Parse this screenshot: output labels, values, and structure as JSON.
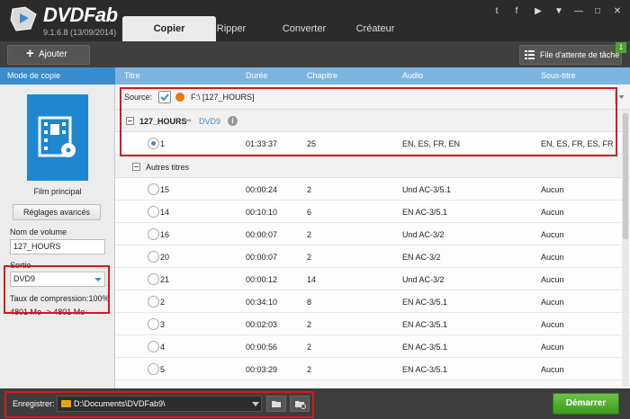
{
  "app": {
    "name": "DVDFab",
    "version": "9.1.6.8 (13/09/2014)"
  },
  "tabs": [
    "Copier",
    "Ripper",
    "Converter",
    "Créateur"
  ],
  "window_controls": {
    "twitter_glyph": "t",
    "facebook_glyph": "f",
    "youtube_glyph": "▶",
    "menu_glyph": "▼",
    "minimize_glyph": "—",
    "maximize_glyph": "□",
    "close_glyph": "✕"
  },
  "toolbar": {
    "add_label": "Ajouter",
    "add_glyph": "+",
    "queue_label": "File d'attente de tâche",
    "queue_badge": "1"
  },
  "left_panel": {
    "header": "Mode de copie",
    "mode_label": "Film principal",
    "advanced_button": "Réglages avancés",
    "volume_label": "Nom de volume",
    "volume_value": "127_HOURS",
    "output_label": "Sortie",
    "output_value": "DVD9",
    "compression_label": "Taux de compression:100%",
    "compression_size": "4801 Mo -> 4801 Mo"
  },
  "columns": {
    "title": "Titre",
    "duration": "Durée",
    "chapter": "Chapitre",
    "audio": "Audio",
    "subtitle": "Sous-titre"
  },
  "source": {
    "label": "Source:",
    "path": "F:\\ [127_HOURS]"
  },
  "main_title": {
    "name": "127_HOURS",
    "arrow": "➦",
    "format": "DVD9",
    "info_glyph": "i",
    "row": {
      "title": "1",
      "duration": "01:33:37",
      "chapter": "25",
      "audio": "EN, ES, FR, EN",
      "subtitle": "EN, ES, FR, ES, FR"
    }
  },
  "other_titles": {
    "label": "Autres titres",
    "rows": [
      {
        "title": "15",
        "duration": "00:00:24",
        "chapter": "2",
        "audio": "Und AC-3/5.1",
        "subtitle": "Aucun"
      },
      {
        "title": "14",
        "duration": "00:10:10",
        "chapter": "6",
        "audio": "EN AC-3/5.1",
        "subtitle": "Aucun"
      },
      {
        "title": "16",
        "duration": "00:00:07",
        "chapter": "2",
        "audio": "Und AC-3/2",
        "subtitle": "Aucun"
      },
      {
        "title": "20",
        "duration": "00:00:07",
        "chapter": "2",
        "audio": "EN AC-3/2",
        "subtitle": "Aucun"
      },
      {
        "title": "21",
        "duration": "00:00:12",
        "chapter": "14",
        "audio": "Und AC-3/2",
        "subtitle": "Aucun"
      },
      {
        "title": "2",
        "duration": "00:34:10",
        "chapter": "8",
        "audio": "EN AC-3/5.1",
        "subtitle": "Aucun"
      },
      {
        "title": "3",
        "duration": "00:02:03",
        "chapter": "2",
        "audio": "EN AC-3/5.1",
        "subtitle": "Aucun"
      },
      {
        "title": "4",
        "duration": "00:00:56",
        "chapter": "2",
        "audio": "EN AC-3/5.1",
        "subtitle": "Aucun"
      },
      {
        "title": "5",
        "duration": "00:03:29",
        "chapter": "2",
        "audio": "EN AC-3/5.1",
        "subtitle": "Aucun"
      }
    ]
  },
  "bottom": {
    "save_label": "Enregistrer:",
    "save_path": "D:\\Documents\\DVDFab9\\",
    "start_button": "Démarrer"
  },
  "colors": {
    "accent_blue": "#3a8ccd",
    "highlight_red": "#d7191c",
    "start_green": "#4ca52f",
    "dark_bar": "#2b2b2b"
  },
  "icons": {
    "logo": "dvdfab-logo-icon",
    "add": "plus-icon",
    "queue": "list-icon",
    "film": "film-disc-icon",
    "folder": "folder-icon"
  }
}
